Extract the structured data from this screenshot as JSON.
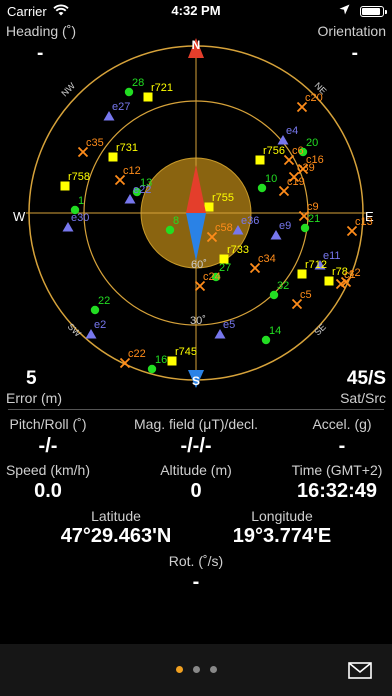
{
  "status": {
    "carrier": "Carrier",
    "time": "4:32 PM",
    "battery_level": 0.9
  },
  "top": {
    "heading_label": "Heading (˚)",
    "heading_value": "-",
    "orientation_label": "Orientation",
    "orientation_value": "-"
  },
  "compass": {
    "north": "N",
    "south": "S",
    "east": "E",
    "west": "W",
    "nw": "NW",
    "ne": "NE",
    "sw": "SW",
    "se": "SE",
    "elev30": "30˚",
    "elev60": "60˚"
  },
  "satellites": [
    {
      "label": "28",
      "type": "circle",
      "color": "#22dd22"
    },
    {
      "label": "r721",
      "type": "square",
      "color": "#ffff00"
    },
    {
      "label": "e27",
      "type": "triangle",
      "color": "#7777ee"
    },
    {
      "label": "c35",
      "type": "cross",
      "color": "#ff8c1a"
    },
    {
      "label": "r731",
      "type": "square",
      "color": "#ffff00"
    },
    {
      "label": "c12",
      "type": "cross",
      "color": "#ff8c1a"
    },
    {
      "label": "r758",
      "type": "square",
      "color": "#ffff00"
    },
    {
      "label": "13",
      "type": "circle",
      "color": "#22dd22"
    },
    {
      "label": "e22",
      "type": "triangle",
      "color": "#7777ee"
    },
    {
      "label": "1",
      "type": "circle",
      "color": "#22dd22"
    },
    {
      "label": "e30",
      "type": "triangle",
      "color": "#7777ee"
    },
    {
      "label": "c20",
      "type": "cross",
      "color": "#ff8c1a"
    },
    {
      "label": "e4",
      "type": "triangle",
      "color": "#7777ee"
    },
    {
      "label": "r756",
      "type": "square",
      "color": "#ffff00"
    },
    {
      "label": "20",
      "type": "circle",
      "color": "#22dd22"
    },
    {
      "label": "c6",
      "type": "cross",
      "color": "#ff8c1a"
    },
    {
      "label": "c16",
      "type": "cross",
      "color": "#ff8c1a"
    },
    {
      "label": "c39",
      "type": "cross",
      "color": "#ff8c1a"
    },
    {
      "label": "10",
      "type": "circle",
      "color": "#22dd22"
    },
    {
      "label": "c19",
      "type": "cross",
      "color": "#ff8c1a"
    },
    {
      "label": "r755",
      "type": "square",
      "color": "#ffff00"
    },
    {
      "label": "c9",
      "type": "cross",
      "color": "#ff8c1a"
    },
    {
      "label": "c13",
      "type": "cross",
      "color": "#ff8c1a"
    },
    {
      "label": "8",
      "type": "circle",
      "color": "#22dd22"
    },
    {
      "label": "e36",
      "type": "triangle",
      "color": "#7777ee"
    },
    {
      "label": "21",
      "type": "circle",
      "color": "#22dd22"
    },
    {
      "label": "c58",
      "type": "cross",
      "color": "#ff8c1a"
    },
    {
      "label": "e9",
      "type": "triangle",
      "color": "#7777ee"
    },
    {
      "label": "e11",
      "type": "triangle",
      "color": "#7777ee"
    },
    {
      "label": "r733",
      "type": "square",
      "color": "#ffff00"
    },
    {
      "label": "c34",
      "type": "cross",
      "color": "#ff8c1a"
    },
    {
      "label": "r712",
      "type": "square",
      "color": "#ffff00"
    },
    {
      "label": "c2",
      "type": "cross",
      "color": "#ff8c1a"
    },
    {
      "label": "27",
      "type": "circle",
      "color": "#22dd22"
    },
    {
      "label": "c24",
      "type": "cross",
      "color": "#ff8c1a"
    },
    {
      "label": "r78",
      "type": "square",
      "color": "#ffff00"
    },
    {
      "label": "c1",
      "type": "cross",
      "color": "#ff8c1a"
    },
    {
      "label": "32",
      "type": "circle",
      "color": "#22dd22"
    },
    {
      "label": "c5",
      "type": "cross",
      "color": "#ff8c1a"
    },
    {
      "label": "22",
      "type": "circle",
      "color": "#22dd22"
    },
    {
      "label": "e2",
      "type": "triangle",
      "color": "#7777ee"
    },
    {
      "label": "14",
      "type": "circle",
      "color": "#22dd22"
    },
    {
      "label": "e5",
      "type": "triangle",
      "color": "#7777ee"
    },
    {
      "label": "c22",
      "type": "cross",
      "color": "#ff8c1a"
    },
    {
      "label": "r745",
      "type": "square",
      "color": "#ffff00"
    },
    {
      "label": "16",
      "type": "circle",
      "color": "#22dd22"
    }
  ],
  "sky_bottom": {
    "error_value": "5",
    "error_label": "Error (m)",
    "sat_value": "45/S",
    "sat_label": "Sat/Src"
  },
  "readings": {
    "pitch_label": "Pitch/Roll (˚)",
    "pitch_value": "-/-",
    "mag_label": "Mag. field (μT)/decl.",
    "mag_value": "-/-/-",
    "accel_label": "Accel. (g)",
    "accel_value": "-",
    "speed_label": "Speed (km/h)",
    "speed_value": "0.0",
    "altitude_label": "Altitude (m)",
    "altitude_value": "0",
    "time_label": "Time (GMT+2)",
    "time_value": "16:32:49",
    "lat_label": "Latitude",
    "lat_value": "47°29.463'N",
    "lon_label": "Longitude",
    "lon_value": "19°3.774'E",
    "rot_label": "Rot. (˚/s)",
    "rot_value": "-"
  },
  "pager": {
    "pages": 3,
    "current": 1
  }
}
